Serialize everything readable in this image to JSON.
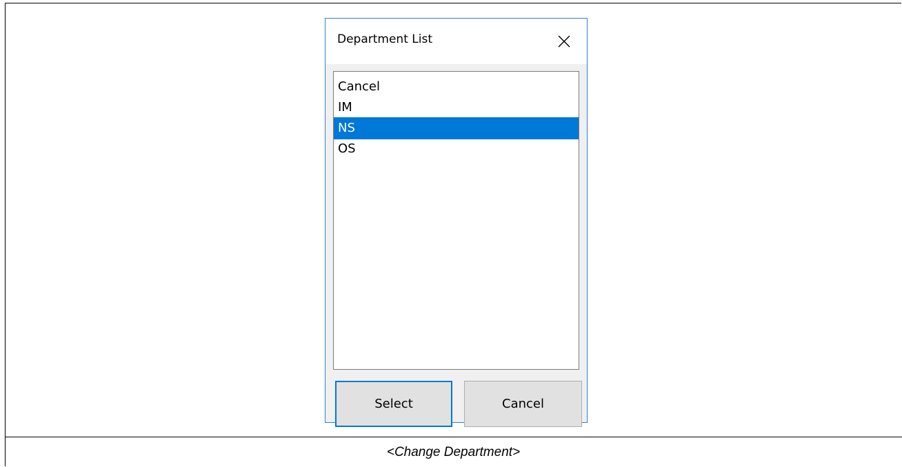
{
  "dialog": {
    "title": "Department List",
    "close_icon": "close-icon",
    "list": {
      "items": [
        "Cancel",
        "IM",
        "NS",
        "OS"
      ],
      "selected_index": 2
    },
    "buttons": {
      "select_label": "Select",
      "cancel_label": "Cancel"
    }
  },
  "caption": "<Change Department>",
  "colors": {
    "selection": "#0078d7",
    "dialog_border": "#2b7fd6",
    "button_face": "#e1e1e1"
  }
}
